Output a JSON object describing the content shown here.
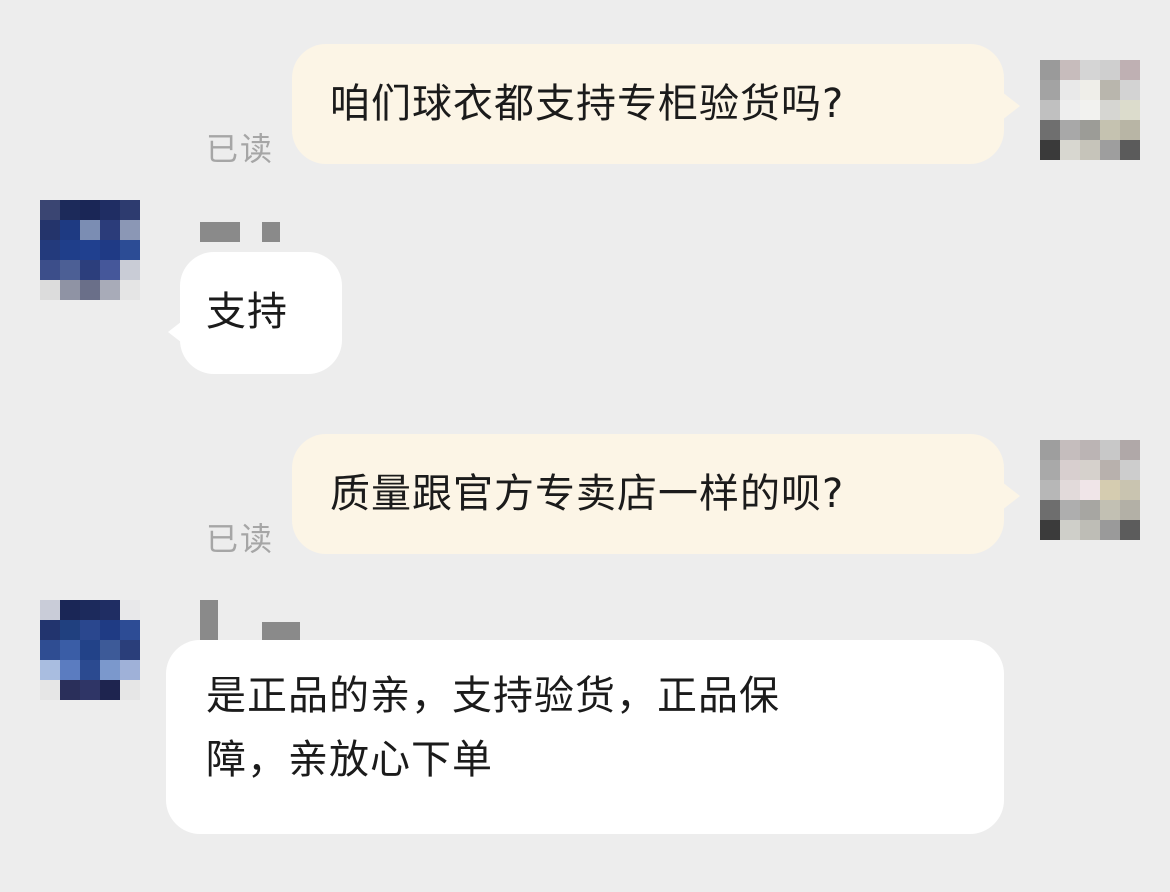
{
  "messages": [
    {
      "id": "m1",
      "direction": "out",
      "text": "咱们球衣都支持专柜验货吗?",
      "status": "已读"
    },
    {
      "id": "m2",
      "direction": "in",
      "text": "支持"
    },
    {
      "id": "m3",
      "direction": "out",
      "text": "质量跟官方专卖店一样的呗?",
      "status": "已读"
    },
    {
      "id": "m4",
      "direction": "in",
      "text": "是正品的亲，支持验货，正品保\n障，亲放心下单"
    }
  ],
  "colors": {
    "background": "#ededed",
    "outgoing_bubble": "#fcf5e6",
    "incoming_bubble": "#ffffff",
    "read_status": "#a6a6a6"
  }
}
